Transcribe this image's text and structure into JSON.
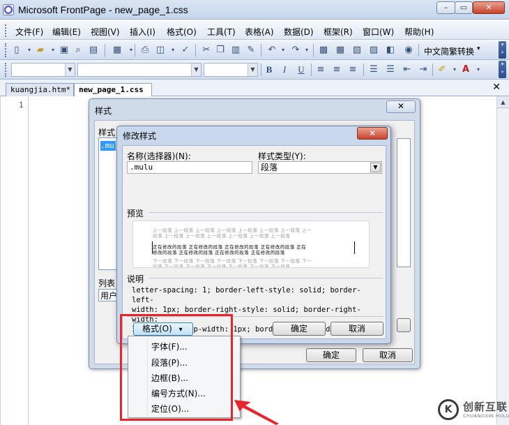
{
  "window": {
    "title": "Microsoft FrontPage - new_page_1.css",
    "controls": {
      "minimize": "–",
      "maximize": "▭",
      "close": "✕"
    }
  },
  "menubar": {
    "items": [
      "文件(F)",
      "编辑(E)",
      "视图(V)",
      "插入(I)",
      "格式(O)",
      "工具(T)",
      "表格(A)",
      "数据(D)",
      "框架(R)",
      "窗口(W)",
      "帮助(H)"
    ]
  },
  "toolbar": {
    "convert_label": "中文简繁转换",
    "convert_arrow": "▾"
  },
  "format_toolbar": {
    "style_value": "",
    "font_value": "",
    "size_value": "",
    "bold": "B",
    "italic": "I",
    "underline": "U"
  },
  "tabs": {
    "items": [
      "kuangjia.htm*",
      "new_page_1.css"
    ],
    "active": 1,
    "close": "✕"
  },
  "editor": {
    "line_numbers": [
      "1"
    ]
  },
  "style_dialog": {
    "title": "样式",
    "close": "✕",
    "styles_label": "样式",
    "selected_style": ".mulu",
    "list_label": "列表",
    "list_value": "用户",
    "ok": "确定",
    "cancel": "取消"
  },
  "modify_dialog": {
    "title": "修改样式",
    "close": "✕",
    "name_label": "名称(选择器)(N):",
    "name_value": ".mulu",
    "type_label": "样式类型(Y):",
    "type_value": "段落",
    "preview_label": "预览",
    "preview": {
      "prev_1": "上一段落 上一段落 上一段落 上一段落 上一段落 上一段落 上一段落 上一",
      "prev_2": "段落 上一段落 上一段落 上一段落 上一段落 上一段落 上一段落",
      "cur_1": "正在修改的段落 正在修改的段落 正在修改的段落 正在修改的段落 正在",
      "cur_2": "修改的段落 正在修改的段落 正在修改的段落 正在修改的段落",
      "next_1": "下一段落 下一段落 下一段落 下一段落 下一段落 下一段落 下一段落 下一",
      "next_2": "段落 下一段落 下一段落 下一段落 下一段落 下一段落 下一段落"
    },
    "desc_label": "说明",
    "desc_lines": [
      "letter-spacing: 1; border-left-style: solid; border-left-",
      "width: 1px; border-right-style: solid; border-right-width:",
      "1px; border-top-width: 1px; border-bottom-width: 1px"
    ],
    "format_button": "格式(O)",
    "format_arrow": "▾",
    "ok": "确定",
    "cancel": "取消"
  },
  "format_menu": {
    "items": [
      "字体(F)...",
      "段落(P)...",
      "边框(B)...",
      "编号方式(N)...",
      "定位(O)..."
    ]
  },
  "watermark": {
    "glyph": "K",
    "cn": "创新互联",
    "en": "CHUANGXIN HULIAN"
  },
  "colors": {
    "annotation_red": "#e8252a",
    "selection_blue": "#3399ff",
    "title_gradient": "#c4d5ec"
  }
}
